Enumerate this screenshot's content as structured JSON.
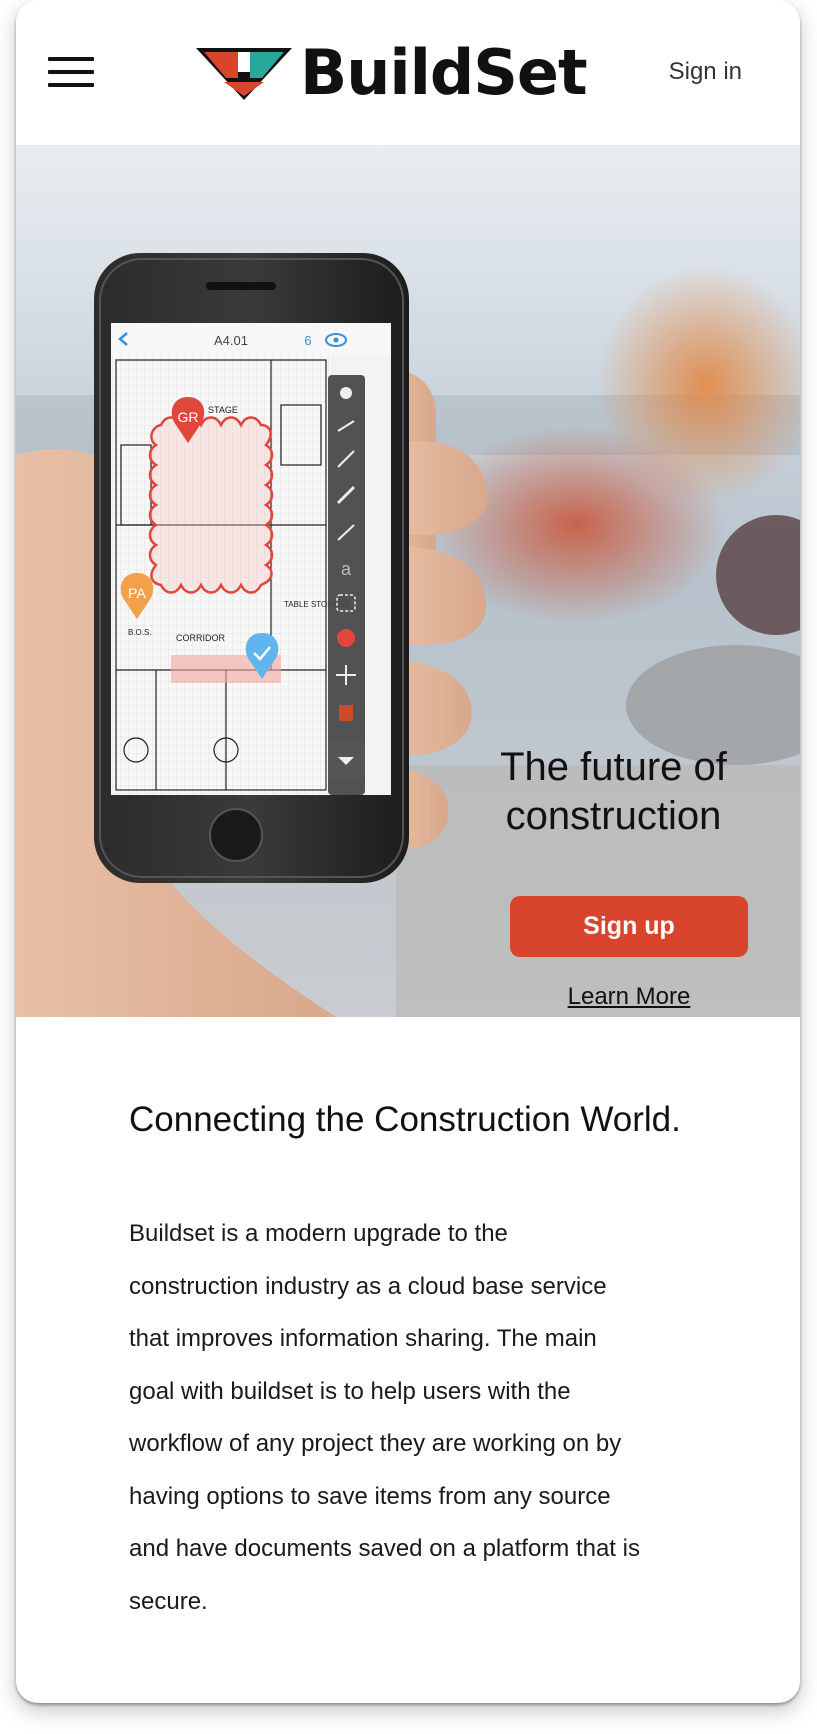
{
  "header": {
    "brand": "BuildSet",
    "signin_label": "Sign in"
  },
  "hero": {
    "title_line1": "The future of",
    "title_line2": "construction",
    "signup_label": "Sign up",
    "learn_more_label": "Learn More",
    "phone_screen": {
      "sheet_title": "A4.01",
      "sheet_count": "6",
      "pins": [
        "GR",
        "PA"
      ],
      "plan_labels": [
        "STAGE",
        "CORRIDOR",
        "TABLE STORAGE",
        "B.O.S."
      ]
    }
  },
  "about": {
    "heading": "Connecting the Construction World.",
    "lines": [
      "Buildset is a modern upgrade to the",
      "construction industry as a cloud base service",
      "that improves information sharing. The main",
      "goal with buildset is to help users with the",
      "workflow of any project they are working on by",
      "having options to save items from any source",
      "and have documents saved on a platform that is",
      "secure."
    ]
  },
  "colors": {
    "accent": "#d9442d",
    "logo_red": "#d9442d",
    "logo_teal": "#2aa79b"
  }
}
